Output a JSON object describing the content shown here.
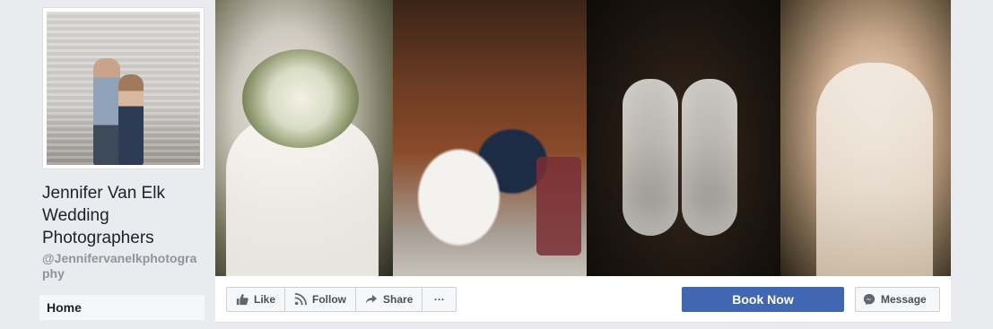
{
  "page": {
    "name": "Jennifer Van Elk Wedding Photographers",
    "handle": "@Jennifervanelkphotography"
  },
  "nav": {
    "items": [
      {
        "label": "Home"
      }
    ]
  },
  "cover": {
    "photos": [
      "bouquet",
      "couple-on-chair",
      "wedding-shoes",
      "bride-blurred"
    ]
  },
  "actions": {
    "like": "Like",
    "follow": "Follow",
    "share": "Share",
    "more": "···",
    "book_now": "Book Now",
    "message": "Message"
  },
  "icons": {
    "like": "thumbs-up-icon",
    "follow": "rss-icon",
    "share": "share-arrow-icon",
    "message": "messenger-icon"
  },
  "colors": {
    "brand_blue": "#4267b2",
    "background": "#e9ebee"
  }
}
